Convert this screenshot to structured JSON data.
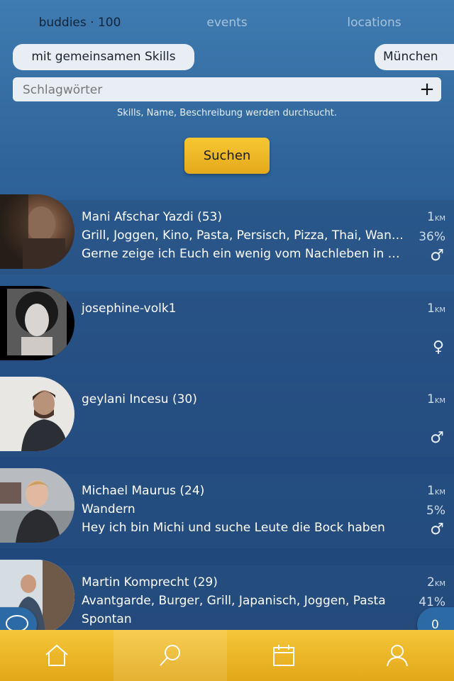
{
  "tabs": {
    "buddies": "buddies · 100",
    "events": "events",
    "locations": "locations"
  },
  "filters": {
    "skills_label": "mit gemeinsamen Skills",
    "city_label": "München"
  },
  "search": {
    "placeholder": "Schlagwörter",
    "add_symbol": "+",
    "hint": "Skills, Name, Beschreibung werden durchsucht.",
    "button_label": "Suchen"
  },
  "buddies": [
    {
      "name": "Mani Afschar Yazdi (53)",
      "skills": "Grill, Joggen, Kino, Pasta, Persisch, Pizza, Thai, Wandern",
      "description": "Gerne zeige ich Euch ein wenig vom Nachleben in München",
      "distance": "1",
      "distance_unit": "KM",
      "match": "36%",
      "gender": "♂"
    },
    {
      "name": "josephine-volk1",
      "skills": "",
      "description": "",
      "distance": "1",
      "distance_unit": "KM",
      "match": "",
      "gender": "♀"
    },
    {
      "name": "geylani Incesu (30)",
      "skills": "",
      "description": "",
      "distance": "1",
      "distance_unit": "KM",
      "match": "",
      "gender": "♂"
    },
    {
      "name": "Michael Maurus (24)",
      "skills": "Wandern",
      "description": "Hey ich bin Michi und suche Leute die Bock haben",
      "distance": "1",
      "distance_unit": "KM",
      "match": "5%",
      "gender": "♂"
    },
    {
      "name": "Martin Komprecht (29)",
      "skills": "Avantgarde, Burger, Grill, Japanisch, Joggen, Pasta",
      "description": "Spontan",
      "distance": "2",
      "distance_unit": "KM",
      "match": "41%",
      "gender": ""
    }
  ],
  "counter": "0",
  "nav": {
    "home_icon": "home-icon",
    "search_icon": "search-icon",
    "calendar_icon": "calendar-icon",
    "profile_icon": "user-icon"
  }
}
